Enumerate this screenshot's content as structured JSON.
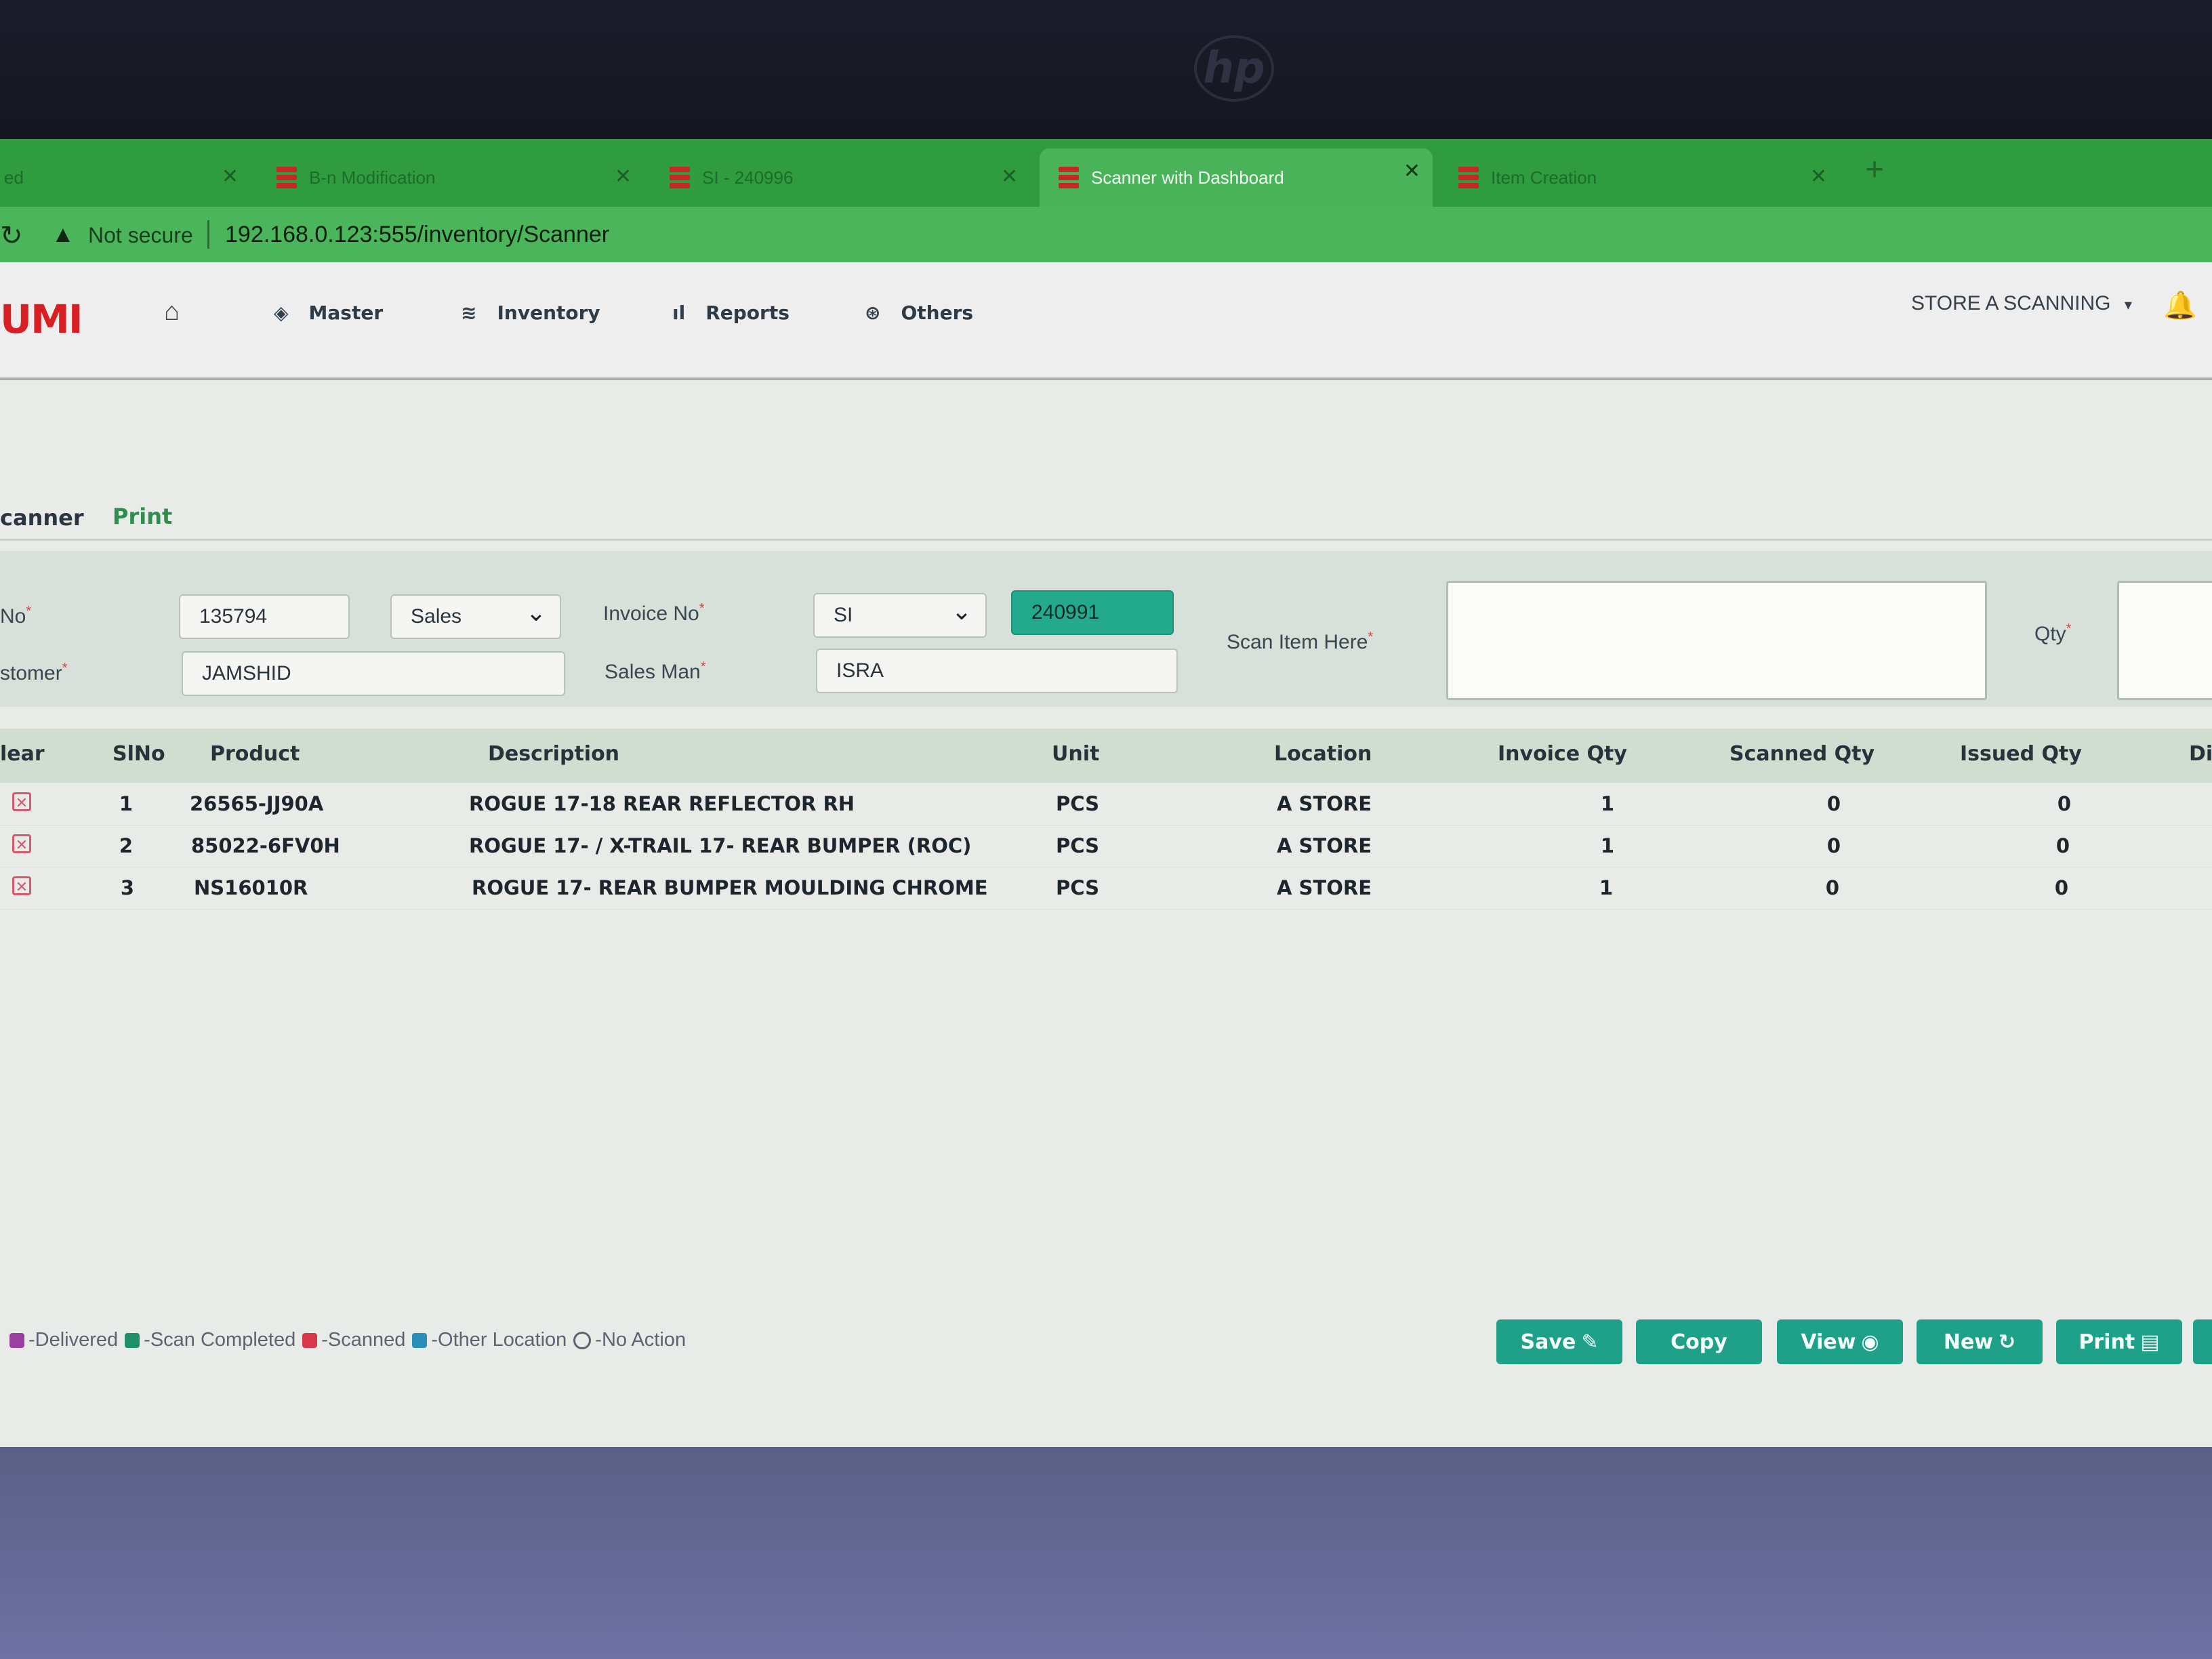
{
  "browser": {
    "tabs": [
      {
        "title": "ed",
        "active": false
      },
      {
        "title": "B-n Modification",
        "active": false
      },
      {
        "title": "SI - 240996",
        "active": false
      },
      {
        "title": "Scanner with Dashboard",
        "active": true
      },
      {
        "title": "Item Creation",
        "active": false
      }
    ],
    "security_label": "Not secure",
    "url": "192.168.0.123:555/inventory/Scanner"
  },
  "header": {
    "logo": "UMI",
    "nav": [
      "Master",
      "Inventory",
      "Reports",
      "Others"
    ],
    "store": "STORE A SCANNING"
  },
  "subtabs": {
    "scanner": "canner",
    "print": "Print"
  },
  "form": {
    "no_label": "No",
    "no_value": "135794",
    "type_value": "Sales",
    "invoice_no_label": "Invoice No",
    "invoice_prefix": "SI",
    "invoice_number": "240991",
    "customer_label": "stomer",
    "customer_value": "JAMSHID",
    "salesman_label": "Sales Man",
    "salesman_value": "ISRA",
    "scan_label": "Scan Item Here",
    "qty_label": "Qty"
  },
  "table": {
    "columns": [
      "lear",
      "SlNo",
      "Product",
      "Description",
      "Unit",
      "Location",
      "Invoice Qty",
      "Scanned Qty",
      "Issued Qty",
      "Di"
    ],
    "rows": [
      {
        "sl": "1",
        "product": "26565-JJ90A",
        "description": "ROGUE 17-18 REAR REFLECTOR RH",
        "unit": "PCS",
        "location": "A STORE",
        "invoice_qty": "1",
        "scanned_qty": "0",
        "issued_qty": "0"
      },
      {
        "sl": "2",
        "product": "85022-6FV0H",
        "description": "ROGUE 17- / X-TRAIL 17- REAR BUMPER (ROC)",
        "unit": "PCS",
        "location": "A STORE",
        "invoice_qty": "1",
        "scanned_qty": "0",
        "issued_qty": "0"
      },
      {
        "sl": "3",
        "product": "NS16010R",
        "description": "ROGUE 17- REAR BUMPER MOULDING CHROME",
        "unit": "PCS",
        "location": "A STORE",
        "invoice_qty": "1",
        "scanned_qty": "0",
        "issued_qty": "0"
      }
    ]
  },
  "legend": [
    {
      "label": "-Delivered",
      "color": "#9a3fa0"
    },
    {
      "label": "-Scan Completed",
      "color": "#1f8f6a"
    },
    {
      "label": "-Scanned",
      "color": "#d8364a"
    },
    {
      "label": "-Other Location",
      "color": "#2a8fb8"
    },
    {
      "label": "-No Action",
      "color": "none"
    }
  ],
  "buttons": {
    "save": "Save",
    "copy": "Copy",
    "view": "View",
    "new": "New",
    "print": "Print"
  },
  "colors": {
    "accent": "#1fa088",
    "browser_green": "#2f9c3f",
    "brand_red": "#d71f24"
  }
}
